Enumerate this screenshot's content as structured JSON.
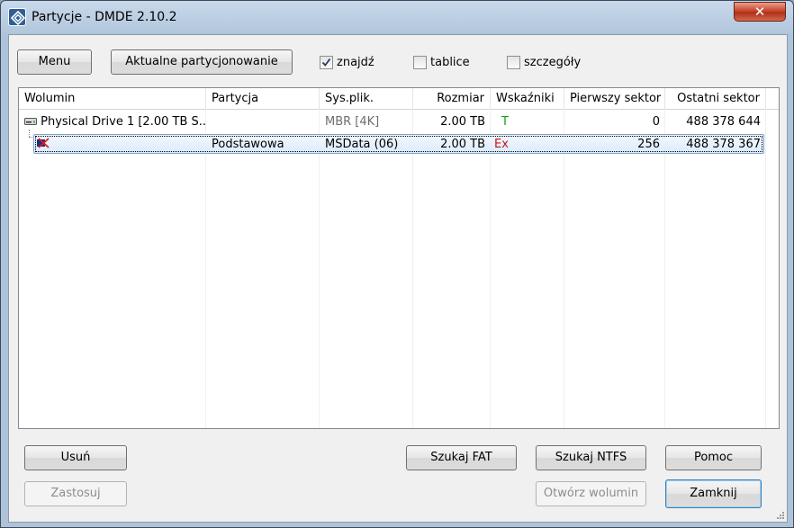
{
  "window": {
    "title": "Partycje - DMDE 2.10.2",
    "close_label": "✕"
  },
  "toolbar": {
    "menu_label": "Menu",
    "current_partitioning_label": "Aktualne partycjonowanie",
    "find": {
      "label": "znajdź",
      "checked": true
    },
    "tables": {
      "label": "tablice",
      "checked": false
    },
    "details": {
      "label": "szczegóły",
      "checked": false
    }
  },
  "table": {
    "columns": [
      "Wolumin",
      "Partycja",
      "Sys.plik.",
      "Rozmiar",
      "Wskaźniki",
      "Pierwszy sektor",
      "Ostatni sektor"
    ],
    "rows": [
      {
        "icon": "hard-drive-icon",
        "volume": "Physical Drive 1 [2.00 TB S...",
        "partition": "",
        "filesystem": "MBR [4K]",
        "size": "2.00 TB",
        "indicator_a": "T",
        "indicator_b": "",
        "first_sector": "0",
        "last_sector": "488 378 644"
      },
      {
        "icon": "broken-partition-icon",
        "volume": "",
        "partition": "Podstawowa",
        "filesystem": "MSData (06)",
        "size": "2.00 TB",
        "indicator_a": "E",
        "indicator_b": "x",
        "first_sector": "256",
        "last_sector": "488 378 367"
      }
    ]
  },
  "buttons": {
    "delete": "Usuń",
    "apply": "Zastosuj",
    "search_fat": "Szukaj FAT",
    "search_ntfs": "Szukaj NTFS",
    "help": "Pomoc",
    "open_volume": "Otwórz wolumin",
    "close": "Zamknij"
  },
  "colors": {
    "indicator_ok": "#18a018",
    "indicator_error": "#d01010",
    "selection": "#dcebfc"
  }
}
